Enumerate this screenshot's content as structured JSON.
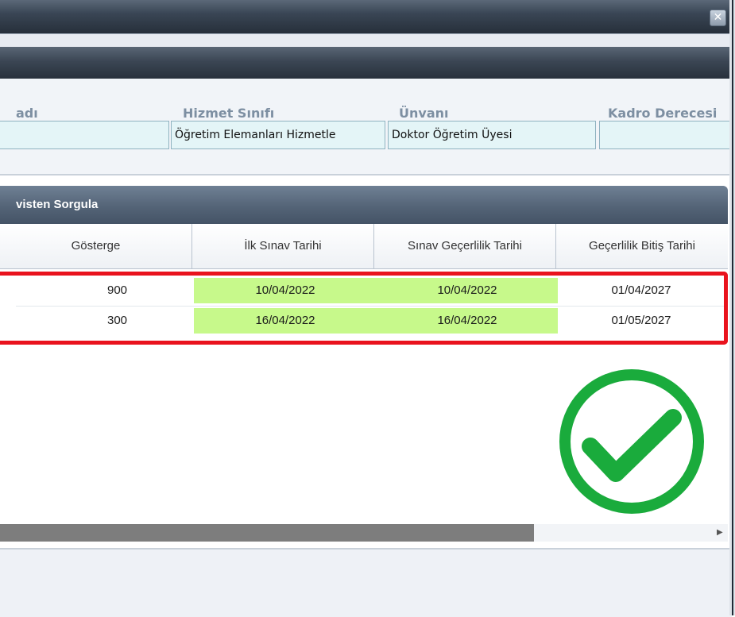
{
  "window": {
    "close_symbol": "✕"
  },
  "form": {
    "fields": [
      {
        "label": "adı",
        "value": ""
      },
      {
        "label": "Hizmet Sınıfı",
        "value": "Öğretim Elemanları Hizmetle"
      },
      {
        "label": "Ünvanı",
        "value": "Doktor Öğretim Üyesi"
      },
      {
        "label": "Kadro Derecesi",
        "value": ""
      }
    ]
  },
  "grid": {
    "title": "visten Sorgula",
    "columns": [
      "Gösterge",
      "İlk Sınav Tarihi",
      "Sınav Geçerlilik Tarihi",
      "Geçerlilik Bitiş Tarihi"
    ],
    "rows": [
      {
        "gosterge": "900",
        "ilk_sinav": "10/04/2022",
        "sinav_gecerlilik": "10/04/2022",
        "gecerlilik_bitis": "01/04/2027"
      },
      {
        "gosterge": "300",
        "ilk_sinav": "16/04/2022",
        "sinav_gecerlilik": "16/04/2022",
        "gecerlilik_bitis": "01/05/2027"
      }
    ]
  },
  "scrollbar": {
    "arrow": "▶"
  },
  "colors": {
    "highlight_border": "#e9131d",
    "highlight_cell": "#c7f98b",
    "check_green": "#1aab3c"
  },
  "icons": {
    "close": "close-icon",
    "check": "checkmark-circle-icon",
    "scroll_right": "scroll-right-arrow-icon"
  }
}
